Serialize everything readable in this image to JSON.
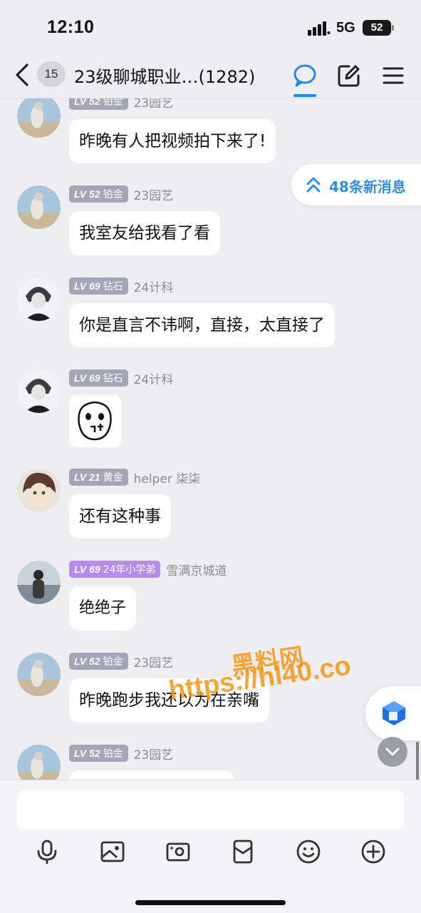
{
  "status_bar": {
    "time": "12:10",
    "network": "5G",
    "battery": "52"
  },
  "header": {
    "unread_count": "15",
    "title": "23级聊城职业…(1282)",
    "accent_color": "#1e8be8",
    "icons": [
      "back-icon",
      "chat-bubble-icon",
      "edit-icon",
      "menu-icon"
    ]
  },
  "new_messages": {
    "label": "48条新消息"
  },
  "messages": [
    {
      "level": "LV 52",
      "tier": "铂金",
      "badge_color": "#a4a5b6",
      "sender": "23园艺",
      "text": "昨晚有人把视频拍下来了!"
    },
    {
      "level": "LV 52",
      "tier": "铂金",
      "badge_color": "#a4a5b6",
      "sender": "23园艺",
      "text": "我室友给我看了看"
    },
    {
      "level": "LV 69",
      "tier": "钻石",
      "badge_color": "#a4a5b6",
      "sender": "24计科",
      "text": "你是直言不讳啊，直接，太直接了"
    },
    {
      "level": "LV 69",
      "tier": "钻石",
      "badge_color": "#a4a5b6",
      "sender": "24计科",
      "text": ""
    },
    {
      "level": "LV 21",
      "tier": "黄金",
      "badge_color": "#a4a5b6",
      "sender": "helper 柒柒",
      "text": "还有这种事"
    },
    {
      "level": "LV 69",
      "tier": "24年小学弟",
      "badge_color": "#b78af0",
      "sender": "雪满京城道",
      "text": "绝绝子"
    },
    {
      "level": "LV 52",
      "tier": "铂金",
      "badge_color": "#a4a5b6",
      "sender": "23园艺",
      "text": "昨晚跑步我还以为在亲嘴"
    },
    {
      "level": "LV 52",
      "tier": "铂金",
      "badge_color": "#a4a5b6",
      "sender": "23园艺",
      "text": ""
    }
  ],
  "watermark": {
    "line1": "黑料网",
    "line2": "https://hl40.co"
  },
  "input": {
    "value": "",
    "placeholder": ""
  },
  "toolbar": {
    "icons": [
      "microphone-icon",
      "image-icon",
      "camera-icon",
      "red-packet-icon",
      "emoji-icon",
      "plus-icon"
    ]
  }
}
